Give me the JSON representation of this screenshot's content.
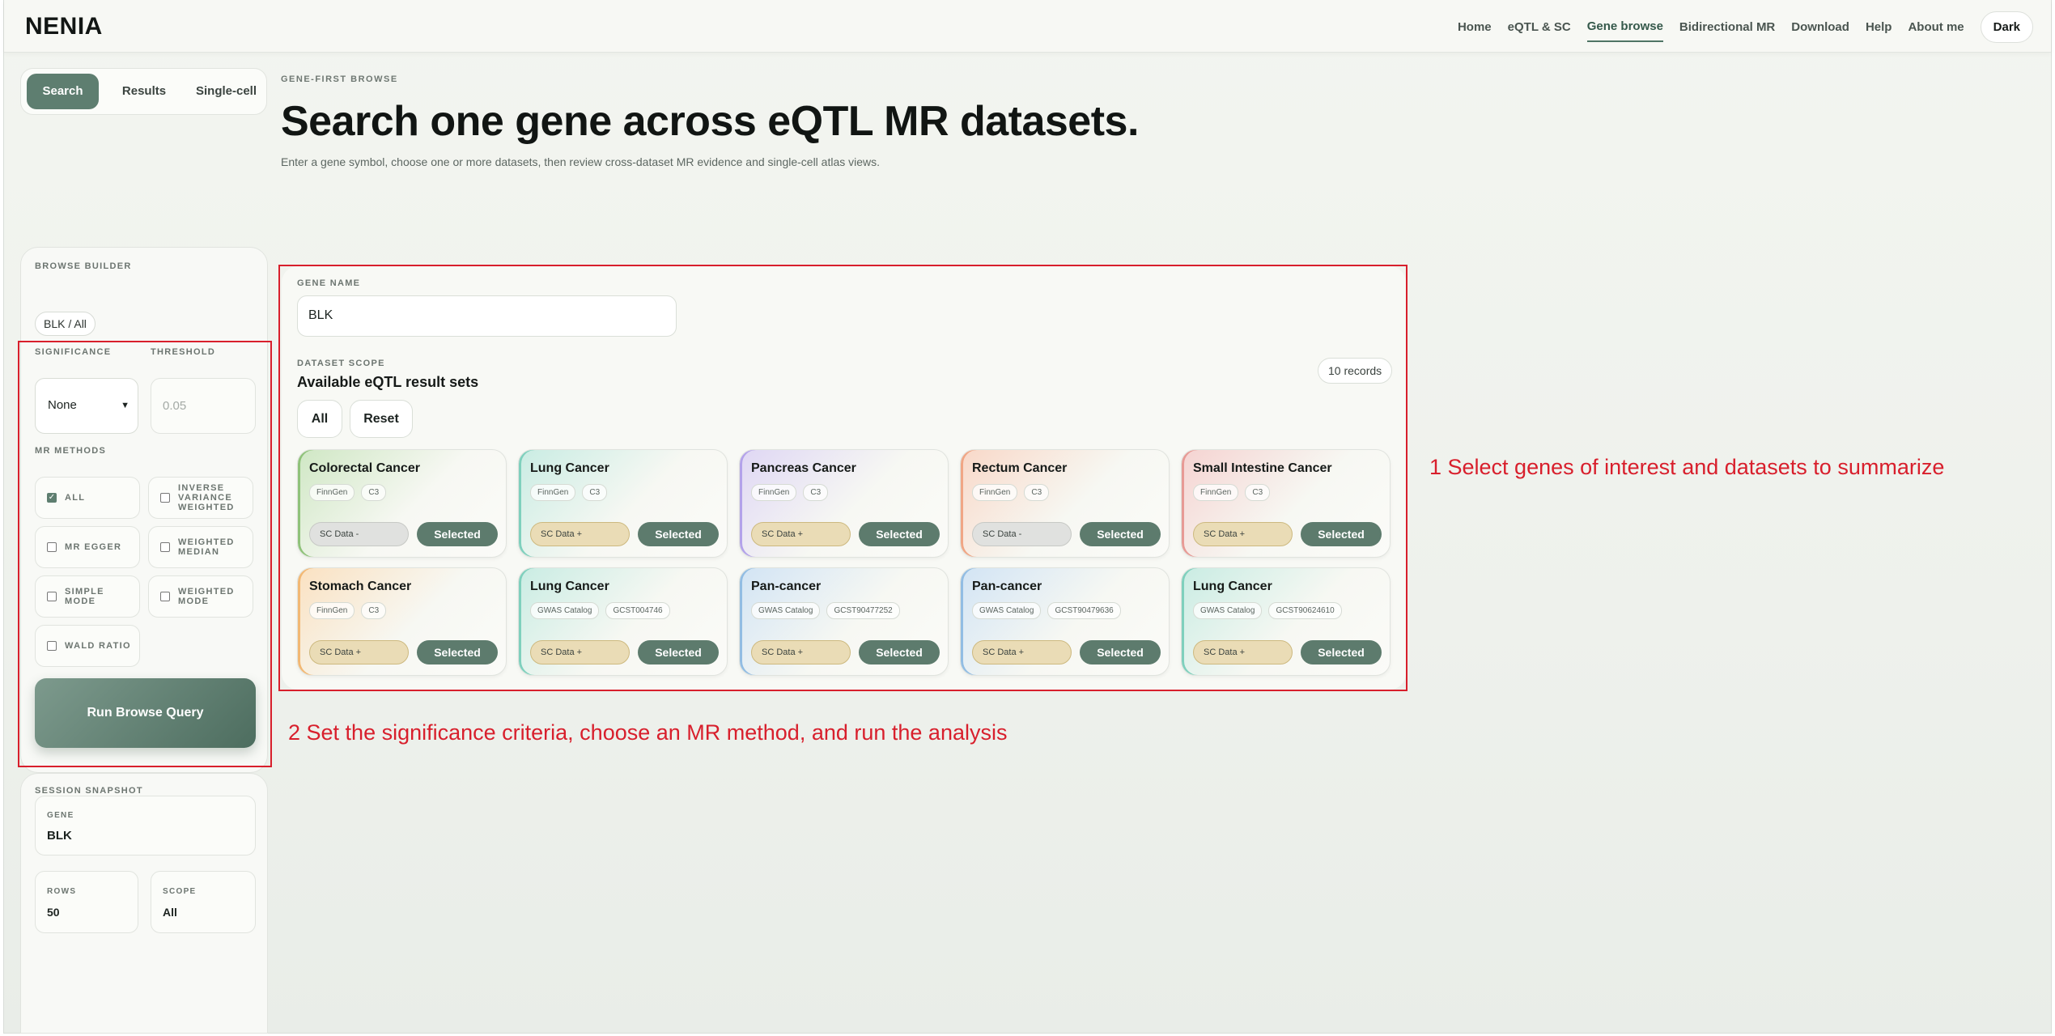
{
  "app": {
    "brand": "NENIA"
  },
  "nav": {
    "links": [
      "Home",
      "eQTL & SC",
      "Gene browse",
      "Bidirectional MR",
      "Download",
      "Help",
      "About me"
    ],
    "theme_button": "Dark"
  },
  "tabs": [
    "Search",
    "Results",
    "Single-cell"
  ],
  "header": {
    "eyebrow": "GENE-FIRST BROWSE",
    "title": "Search one gene across eQTL MR datasets.",
    "subtitle": "Enter a gene symbol, choose one or more datasets, then review cross-dataset MR evidence and single-cell atlas views."
  },
  "builder": {
    "label": "BROWSE BUILDER",
    "chip": "BLK / All",
    "significance_label": "SIGNIFICANCE",
    "threshold_label": "THRESHOLD",
    "significance_value": "None",
    "threshold_placeholder": "0.05",
    "methods_label": "MR METHODS",
    "methods": [
      {
        "l1": "ALL",
        "l2": "",
        "l3": "",
        "checked": true
      },
      {
        "l1": "INVERSE",
        "l2": "VARIANCE",
        "l3": "WEIGHTED",
        "checked": false
      },
      {
        "l1": "MR EGGER",
        "l2": "",
        "l3": "",
        "checked": false
      },
      {
        "l1": "WEIGHTED",
        "l2": "MEDIAN",
        "l3": "",
        "checked": false
      },
      {
        "l1": "SIMPLE",
        "l2": "MODE",
        "l3": "",
        "checked": false
      },
      {
        "l1": "WEIGHTED",
        "l2": "MODE",
        "l3": "",
        "checked": false
      },
      {
        "l1": "WALD RATIO",
        "l2": "",
        "l3": "",
        "checked": false
      }
    ],
    "run_button": "Run Browse Query"
  },
  "snapshot": {
    "label": "SESSION SNAPSHOT",
    "gene_label": "GENE",
    "gene_value": "BLK",
    "rows_label": "ROWS",
    "rows_value": "50",
    "scope_label": "SCOPE",
    "scope_value": "All"
  },
  "main": {
    "gene_name_label": "GENE NAME",
    "gene_value": "BLK",
    "scope_label": "DATASET SCOPE",
    "heading": "Available eQTL result sets",
    "records": "10 records",
    "all_button": "All",
    "reset_button": "Reset",
    "cards": [
      {
        "title": "Colorectal Cancer",
        "tags": [
          "FinnGen",
          "C3"
        ],
        "sc": "SC Data -",
        "sc_state": "minus",
        "button": "Selected",
        "tint": "#cfe7c4",
        "edge": "#8fc27a"
      },
      {
        "title": "Lung Cancer",
        "tags": [
          "FinnGen",
          "C3"
        ],
        "sc": "SC Data +",
        "sc_state": "plus",
        "button": "Selected",
        "tint": "#c9ece3",
        "edge": "#7fd0bd"
      },
      {
        "title": "Pancreas Cancer",
        "tags": [
          "FinnGen",
          "C3"
        ],
        "sc": "SC Data +",
        "sc_state": "plus",
        "button": "Selected",
        "tint": "#dfd7f4",
        "edge": "#b3a2ea"
      },
      {
        "title": "Rectum Cancer",
        "tags": [
          "FinnGen",
          "C3"
        ],
        "sc": "SC Data -",
        "sc_state": "minus",
        "button": "Selected",
        "tint": "#f8d8c8",
        "edge": "#f0a685"
      },
      {
        "title": "Small Intestine Cancer",
        "tags": [
          "FinnGen",
          "C3"
        ],
        "sc": "SC Data +",
        "sc_state": "plus",
        "button": "Selected",
        "tint": "#f5d3d1",
        "edge": "#e79a95"
      },
      {
        "title": "Stomach Cancer",
        "tags": [
          "FinnGen",
          "C3"
        ],
        "sc": "SC Data +",
        "sc_state": "plus",
        "button": "Selected",
        "tint": "#fae1c1",
        "edge": "#f2b874"
      },
      {
        "title": "Lung Cancer",
        "tags": [
          "GWAS Catalog",
          "GCST004746"
        ],
        "sc": "SC Data +",
        "sc_state": "plus",
        "button": "Selected",
        "tint": "#c9ece3",
        "edge": "#7fd0bd"
      },
      {
        "title": "Pan-cancer",
        "tags": [
          "GWAS Catalog",
          "GCST90477252"
        ],
        "sc": "SC Data +",
        "sc_state": "plus",
        "button": "Selected",
        "tint": "#d2e4f4",
        "edge": "#92bde3"
      },
      {
        "title": "Pan-cancer",
        "tags": [
          "GWAS Catalog",
          "GCST90479636"
        ],
        "sc": "SC Data +",
        "sc_state": "plus",
        "button": "Selected",
        "tint": "#d2e4f4",
        "edge": "#92bde3"
      },
      {
        "title": "Lung Cancer",
        "tags": [
          "GWAS Catalog",
          "GCST90624610"
        ],
        "sc": "SC Data +",
        "sc_state": "plus",
        "button": "Selected",
        "tint": "#c9ece3",
        "edge": "#7fd0bd"
      }
    ]
  },
  "annotations": {
    "step1": "1 Select genes of interest and datasets to summarize",
    "step2": "2 Set the significance criteria, choose an MR method, and run the analysis"
  },
  "colors": {
    "accent": "#5e7e70",
    "annotation_red": "#d81f2c"
  }
}
